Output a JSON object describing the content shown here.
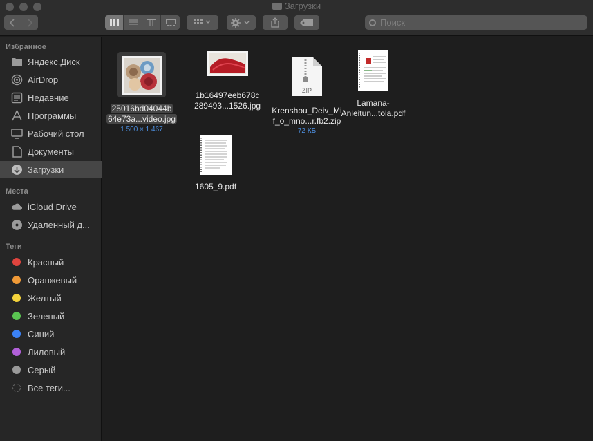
{
  "window": {
    "title": "Загрузки"
  },
  "toolbar": {
    "back_icon": "chevron-left-icon",
    "forward_icon": "chevron-right-icon",
    "view_modes": [
      "icon-view",
      "list-view",
      "column-view",
      "gallery-view"
    ],
    "search_placeholder": "Поиск"
  },
  "sidebar": {
    "favorites_title": "Избранное",
    "favorites": [
      {
        "label": "Яндекс.Диск",
        "icon": "folder-icon"
      },
      {
        "label": "AirDrop",
        "icon": "airdrop-icon"
      },
      {
        "label": "Недавние",
        "icon": "clock-icon"
      },
      {
        "label": "Программы",
        "icon": "apps-icon"
      },
      {
        "label": "Рабочий стол",
        "icon": "desktop-icon"
      },
      {
        "label": "Документы",
        "icon": "document-icon"
      },
      {
        "label": "Загрузки",
        "icon": "download-icon",
        "selected": true
      }
    ],
    "places_title": "Места",
    "places": [
      {
        "label": "iCloud Drive",
        "icon": "cloud-icon"
      },
      {
        "label": "Удаленный д...",
        "icon": "disc-icon"
      }
    ],
    "tags_title": "Теги",
    "tags": [
      {
        "label": "Красный",
        "color": "#e0443e"
      },
      {
        "label": "Оранжевый",
        "color": "#f09a37"
      },
      {
        "label": "Желтый",
        "color": "#f4d33b"
      },
      {
        "label": "Зеленый",
        "color": "#5ac451"
      },
      {
        "label": "Синий",
        "color": "#3b82f6"
      },
      {
        "label": "Лиловый",
        "color": "#b260d9"
      },
      {
        "label": "Серый",
        "color": "#9a9a9a"
      },
      {
        "label": "Все теги...",
        "color": ""
      }
    ]
  },
  "files": [
    {
      "line1": "25016bd04044b",
      "line2": "64e73a...video.jpg",
      "meta": "1 500 × 1 467",
      "kind": "jpg-bowls",
      "selected": true
    },
    {
      "line1": "1b16497eeb678c",
      "line2": "289493...1526.jpg",
      "meta": "",
      "kind": "jpg-red"
    },
    {
      "line1": "Krenshou_Deiv_Mi",
      "line2": "f_o_mno...r.fb2.zip",
      "meta": "72 КБ",
      "kind": "zip",
      "zip_label": "ZIP"
    },
    {
      "line1": "Lamana-",
      "line2": "Anleitun...tola.pdf",
      "meta": "",
      "kind": "pdf"
    },
    {
      "line1": "1605_9.pdf",
      "line2": "",
      "meta": "",
      "kind": "pdf2"
    }
  ]
}
